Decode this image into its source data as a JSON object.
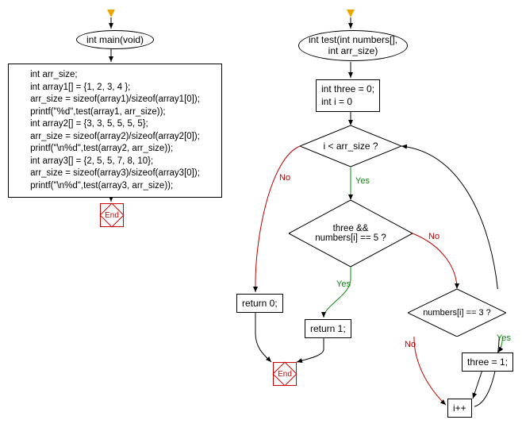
{
  "left": {
    "func_signature": "int main(void)",
    "code": "int arr_size;\nint array1[] = {1, 2, 3, 4 };\narr_size = sizeof(array1)/sizeof(array1[0]);\nprintf(\"%d\",test(array1, arr_size));\nint array2[] = {3, 3, 5, 5, 5, 5};\narr_size = sizeof(array2)/sizeof(array2[0]);\nprintf(\"\\n%d\",test(array2, arr_size));\nint array3[] = {2, 5, 5, 7, 8, 10};\narr_size = sizeof(array3)/sizeof(array3[0]);\nprintf(\"\\n%d\",test(array3, arr_size));",
    "end": "End"
  },
  "right": {
    "func_signature": "int test(int numbers[],\nint arr_size)",
    "init": "int three = 0;\nint i = 0",
    "cond1": "i < arr_size ?",
    "cond2": "three &&\nnumbers[i] == 5 ?",
    "cond3": "numbers[i] == 3 ?",
    "ret0": "return 0;",
    "ret1": "return 1;",
    "set3": "three = 1;",
    "inc": "i++",
    "end": "End"
  },
  "labels": {
    "yes": "Yes",
    "no": "No"
  },
  "chart_data": {
    "type": "flowchart",
    "charts": [
      {
        "name": "main",
        "nodes": [
          {
            "id": "main_start",
            "kind": "start"
          },
          {
            "id": "main_sig",
            "kind": "ellipse",
            "text": "int main(void)"
          },
          {
            "id": "main_code",
            "kind": "process",
            "text": "int arr_size;\nint array1[] = {1, 2, 3, 4 };\narr_size = sizeof(array1)/sizeof(array1[0]);\nprintf(\"%d\",test(array1, arr_size));\nint array2[] = {3, 3, 5, 5, 5, 5};\narr_size = sizeof(array2)/sizeof(array2[0]);\nprintf(\"\\n%d\",test(array2, arr_size));\nint array3[] = {2, 5, 5, 7, 8, 10};\narr_size = sizeof(array3)/sizeof(array3[0]);\nprintf(\"\\n%d\",test(array3, arr_size));"
          },
          {
            "id": "main_end",
            "kind": "terminator",
            "text": "End"
          }
        ],
        "edges": [
          {
            "from": "main_start",
            "to": "main_sig"
          },
          {
            "from": "main_sig",
            "to": "main_code"
          },
          {
            "from": "main_code",
            "to": "main_end"
          }
        ]
      },
      {
        "name": "test",
        "nodes": [
          {
            "id": "t_start",
            "kind": "start"
          },
          {
            "id": "t_sig",
            "kind": "ellipse",
            "text": "int test(int numbers[], int arr_size)"
          },
          {
            "id": "t_init",
            "kind": "process",
            "text": "int three = 0;\nint i = 0"
          },
          {
            "id": "t_cond1",
            "kind": "decision",
            "text": "i < arr_size ?"
          },
          {
            "id": "t_cond2",
            "kind": "decision",
            "text": "three && numbers[i] == 5 ?"
          },
          {
            "id": "t_cond3",
            "kind": "decision",
            "text": "numbers[i] == 3 ?"
          },
          {
            "id": "t_ret0",
            "kind": "process",
            "text": "return 0;"
          },
          {
            "id": "t_ret1",
            "kind": "process",
            "text": "return 1;"
          },
          {
            "id": "t_set3",
            "kind": "process",
            "text": "three = 1;"
          },
          {
            "id": "t_inc",
            "kind": "process",
            "text": "i++"
          },
          {
            "id": "t_end",
            "kind": "terminator",
            "text": "End"
          }
        ],
        "edges": [
          {
            "from": "t_start",
            "to": "t_sig"
          },
          {
            "from": "t_sig",
            "to": "t_init"
          },
          {
            "from": "t_init",
            "to": "t_cond1"
          },
          {
            "from": "t_cond1",
            "to": "t_cond2",
            "label": "Yes"
          },
          {
            "from": "t_cond1",
            "to": "t_ret0",
            "label": "No"
          },
          {
            "from": "t_cond2",
            "to": "t_ret1",
            "label": "Yes"
          },
          {
            "from": "t_cond2",
            "to": "t_cond3",
            "label": "No"
          },
          {
            "from": "t_cond3",
            "to": "t_set3",
            "label": "Yes"
          },
          {
            "from": "t_cond3",
            "to": "t_inc",
            "label": "No"
          },
          {
            "from": "t_set3",
            "to": "t_inc"
          },
          {
            "from": "t_inc",
            "to": "t_cond1"
          },
          {
            "from": "t_ret0",
            "to": "t_end"
          },
          {
            "from": "t_ret1",
            "to": "t_end"
          }
        ]
      }
    ]
  }
}
